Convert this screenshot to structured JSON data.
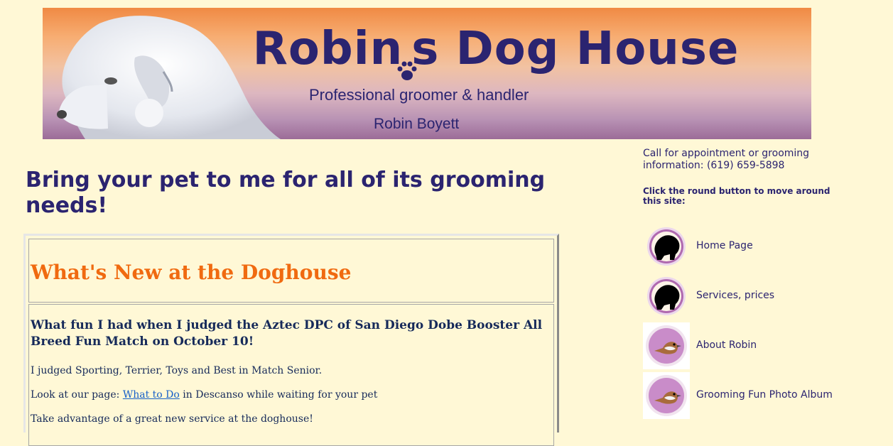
{
  "banner": {
    "title_part1": "Robin",
    "title_part2": "s Dog House",
    "subtitle": "Professional groomer & handler",
    "name": "Robin Boyett"
  },
  "headline": "Bring your pet to me for all of its grooming needs!",
  "news": {
    "heading": "What's New at the Doghouse",
    "item_title": "What fun I had when I judged the Aztec DPC of San Diego Dobe Booster All Breed Fun Match on October 10!",
    "line1": "I judged Sporting, Terrier, Toys and Best in Match Senior.",
    "line2_prefix": "Look at our page: ",
    "line2_link": "What to Do",
    "line2_suffix": " in Descanso while waiting for your pet",
    "line3": "Take advantage of a great new service at the doghouse!"
  },
  "sidebar": {
    "call": "Call for appointment or grooming information: (619) 659-5898",
    "instructions": "Click the round button to move around this site:",
    "nav": [
      {
        "label": "Home Page",
        "icon": "dog-silhouette-icon"
      },
      {
        "label": "Services, prices",
        "icon": "dog-silhouette-icon"
      },
      {
        "label": "About Robin",
        "icon": "bird-icon"
      },
      {
        "label": "Grooming Fun Photo Album",
        "icon": "bird-icon"
      }
    ]
  },
  "colors": {
    "background": "#fff8d6",
    "navy": "#2b2470",
    "orange": "#f06a10",
    "link": "#1660c8"
  }
}
